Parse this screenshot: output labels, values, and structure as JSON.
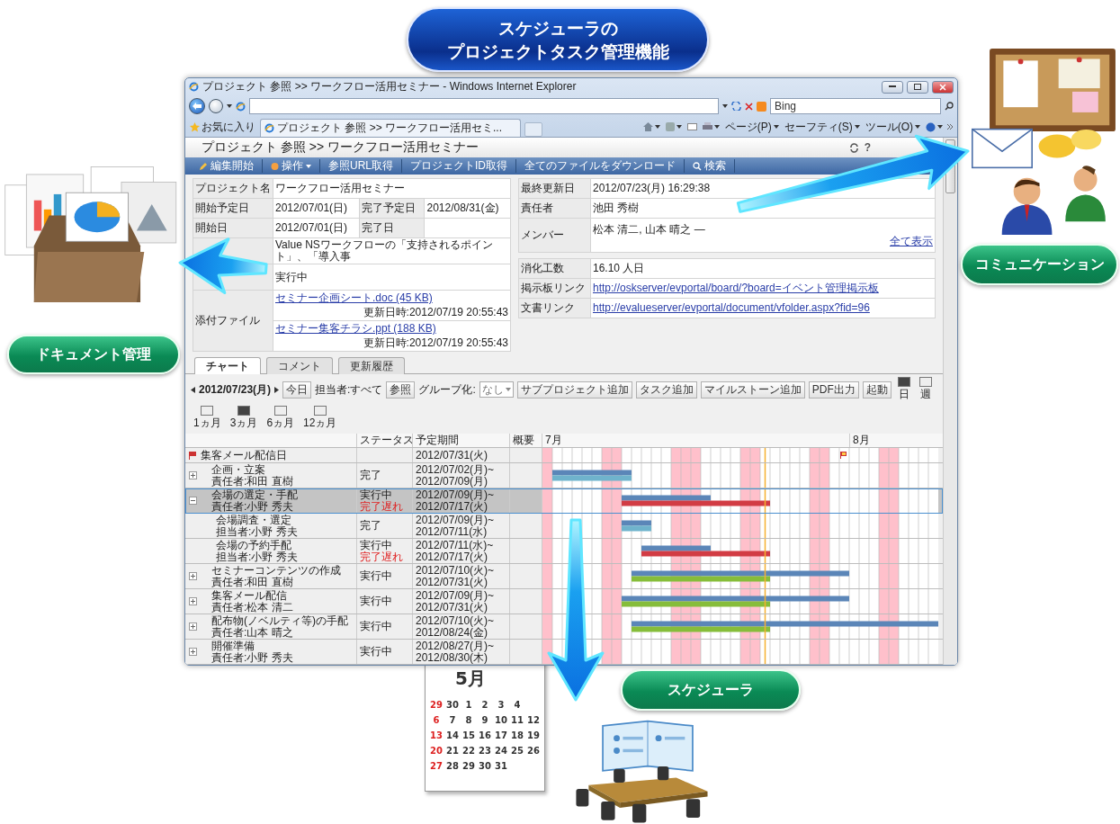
{
  "title_badge": {
    "lines": [
      "スケジューラの",
      "プロジェクトタスク管理機能"
    ]
  },
  "labels": [
    {
      "kind": "documents",
      "text": "ドキュメント管理"
    },
    {
      "kind": "communication",
      "text": "コミュニケーション"
    },
    {
      "kind": "scheduler",
      "text": "スケジューラ"
    }
  ],
  "calendar": {
    "month": "5月",
    "weeks": [
      [
        "29",
        "30",
        "1",
        "2",
        "3",
        "4"
      ],
      [
        "6",
        "7",
        "8",
        "9",
        "10",
        "11",
        "12"
      ],
      [
        "13",
        "14",
        "15",
        "16",
        "17",
        "18",
        "19"
      ],
      [
        "20",
        "21",
        "22",
        "23",
        "24",
        "25",
        "26"
      ],
      [
        "27",
        "28",
        "29",
        "30",
        "31"
      ]
    ]
  },
  "browser": {
    "title": "プロジェクト 参照 >> ワークフロー活用セミナー - Windows Internet Explorer",
    "search_placeholder": "Bing",
    "favorites": "お気に入り",
    "tab": "プロジェクト 参照 >> ワークフロー活用セミ...",
    "commands": [
      "ページ(P)",
      "セーフティ(S)",
      "ツール(O)"
    ]
  },
  "page": {
    "title": "プロジェクト 参照 >> ワークフロー活用セミナー",
    "help": "?",
    "toolbar": [
      {
        "kind": "edit",
        "label": "編集開始"
      },
      {
        "kind": "menu",
        "label": "操作"
      },
      {
        "kind": "plain",
        "label": "参照URL取得"
      },
      {
        "kind": "plain",
        "label": "プロジェクトID取得"
      },
      {
        "kind": "plain",
        "label": "全てのファイルをダウンロード"
      },
      {
        "kind": "search",
        "label": "検索"
      }
    ]
  },
  "details": [
    {
      "label": "プロジェクト名",
      "value": "ワークフロー活用セミナー"
    },
    {
      "label": "開始予定日",
      "value": "2012/07/01(日)",
      "label2": "完了予定日",
      "value2": "2012/08/31(金)"
    },
    {
      "label": "開始日",
      "value": "2012/07/01(日)",
      "label2": "完了日"
    },
    {
      "value": "Value NSワークフローの「支持されるポイント」、「導入事"
    },
    {
      "value": "実行中"
    }
  ],
  "attachments": {
    "label": "添付ファイル",
    "files": [
      {
        "name": "セミナー企画シート.doc (45 KB)",
        "updated": "更新日時:2012/07/19 20:55:43"
      },
      {
        "name": "セミナー集客チラシ.ppt (188 KB)",
        "updated": "更新日時:2012/07/19 20:55:43"
      }
    ]
  },
  "info": [
    {
      "label": "最終更新日",
      "value": "2012/07/23(月) 16:29:38"
    },
    {
      "label": "責任者",
      "value": "池田 秀樹"
    },
    {
      "label": "メンバー",
      "value": "松本 清二, 山本 晴之 —",
      "link": "全て表示"
    }
  ],
  "effort": [
    {
      "label": "消化工数",
      "value": "16.10 人日"
    },
    {
      "label": "掲示板リンク",
      "link": "http://oskserver/evportal/board/?board=イベント管理掲示板"
    },
    {
      "label": "文書リンク",
      "link": "http://evalueserver/evportal/document/vfolder.aspx?fid=96"
    }
  ],
  "page_tabs": [
    {
      "label": "チャート",
      "selected": true
    },
    {
      "label": "コメント",
      "selected": false
    },
    {
      "label": "更新履歴",
      "selected": false
    }
  ],
  "gantt": {
    "date": "2012/07/23(月)",
    "today": "今日",
    "assignee": "担当者:すべて",
    "browse": "参照",
    "group_label": "グループ化:",
    "group_value": "なし",
    "actions": [
      "サブプロジェクト追加",
      "タスク追加",
      "マイルストーン追加",
      "PDF出力",
      "起動"
    ],
    "scales": [
      {
        "label": "日",
        "selected": true
      },
      {
        "label": "週",
        "selected": false
      },
      {
        "label": "1ヵ月",
        "selected": false
      },
      {
        "label": "3ヵ月",
        "selected": true
      },
      {
        "label": "6ヵ月",
        "selected": false
      },
      {
        "label": "12ヵ月",
        "selected": false
      }
    ],
    "columns": [
      "ステータス",
      "予定期間",
      "概要"
    ],
    "months": [
      "7月",
      "8月"
    ],
    "tasks": [
      {
        "kind": "milestone",
        "name": "集客メール配信日",
        "period": [
          "2012/07/31(火)"
        ]
      },
      {
        "kind": "task",
        "name": "企画・立案",
        "owner": "責任者:和田 直樹",
        "status": "完了",
        "color": "#6fb3cc",
        "expanded": false,
        "selected": false,
        "period": [
          "2012/07/02(月)~",
          "2012/07/09(月)"
        ]
      },
      {
        "kind": "task",
        "name": "会場の選定・手配",
        "owner": "責任者:小野 秀夫",
        "status": "実行中",
        "alert": "完了遅れ",
        "color": "#d23c44",
        "expanded": true,
        "selected": true,
        "period": [
          "2012/07/09(月)~",
          "2012/07/17(火)"
        ],
        "children": [
          {
            "kind": "task",
            "name": "会場調査・選定",
            "owner": "担当者:小野 秀夫",
            "status": "完了",
            "color": "#6fb3cc",
            "selected": false,
            "period": [
              "2012/07/09(月)~",
              "2012/07/11(水)"
            ]
          },
          {
            "kind": "task",
            "name": "会場の予約手配",
            "owner": "担当者:小野 秀夫",
            "status": "実行中",
            "alert": "完了遅れ",
            "color": "#d23c44",
            "selected": false,
            "period": [
              "2012/07/11(水)~",
              "2012/07/17(火)"
            ]
          }
        ]
      },
      {
        "kind": "task",
        "name": "セミナーコンテンツの作成",
        "owner": "責任者:和田 直樹",
        "status": "実行中",
        "color": "#86bd3a",
        "expanded": false,
        "selected": false,
        "period": [
          "2012/07/10(火)~",
          "2012/07/31(火)"
        ]
      },
      {
        "kind": "task",
        "name": "集客メール配信",
        "owner": "責任者:松本 清二",
        "status": "実行中",
        "color": "#86bd3a",
        "expanded": false,
        "selected": false,
        "period": [
          "2012/07/09(月)~",
          "2012/07/31(火)"
        ]
      },
      {
        "kind": "task",
        "name": "配布物(ノベルティ等)の手配",
        "owner": "責任者:山本 晴之",
        "status": "実行中",
        "color": "#86bd3a",
        "expanded": false,
        "selected": false,
        "period": [
          "2012/07/10(火)~",
          "2012/08/24(金)"
        ]
      },
      {
        "kind": "task",
        "name": "開催準備",
        "owner": "責任者:小野 秀夫",
        "status": "実行中",
        "expanded": false,
        "selected": false,
        "period": [
          "2012/08/27(月)~",
          "2012/08/30(木)"
        ]
      }
    ]
  }
}
